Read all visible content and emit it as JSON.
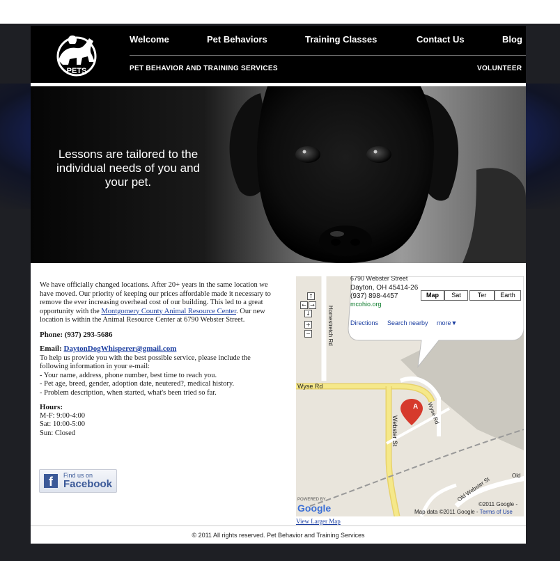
{
  "nav": {
    "items": [
      "Welcome",
      "Pet Behaviors",
      "Training Classes",
      "Contact Us",
      "Blog"
    ],
    "subtitle": "PET BEHAVIOR AND TRAINING SERVICES",
    "volunteer": "VOLUNTEER"
  },
  "logo": {
    "text": "PETS"
  },
  "hero": {
    "tagline": "Lessons are tailored to the individual needs of you and your pet."
  },
  "content": {
    "intro_pre": "We have officially changed locations. After 20+ years in the same location we have moved. Our priority of keeping our prices affordable made it necessary to remove the ever increasing overhead cost of our building. This led to a great opportunity with the ",
    "intro_link": "Montgomery County Animal Resource Center",
    "intro_post": ". Our new location is within the Animal Resource Center at 6790 Webster Street.",
    "phone": "Phone: (937) 293-5686",
    "email_label": "Email: ",
    "email": "DaytonDogWhisperer@gmail.com",
    "email_help": "To help us provide you with the best possible service, please include the following information in your e-mail:",
    "bullets": [
      "- Your name, address, phone number, best time to reach you.",
      "- Pet age, breed, gender, adoption date, neutered?, medical history.",
      "- Problem description, when started, what's been tried so far."
    ],
    "hours_title": "Hours:",
    "hours": [
      "M-F: 9:00-4:00",
      "Sat: 10:00-5:00",
      "Sun: Closed"
    ],
    "facebook_small": "Find us on",
    "facebook_big": "Facebook"
  },
  "map": {
    "street_line": "6790 Webster Street",
    "city_line": "Dayton, OH 45414-26",
    "phone": "(937) 898-4457",
    "site": "mcohio.org",
    "links": [
      "Directions",
      "Search nearby",
      "more▼"
    ],
    "types": [
      "Map",
      "Sat",
      "Ter",
      "Earth"
    ],
    "roads": [
      "Wyse Rd",
      "Webster St",
      "Homestretch Rd",
      "Wyse Rd",
      "Old Webster St",
      "Old"
    ],
    "marker": "A",
    "powered": "POWERED BY",
    "google": "Google",
    "copyright1": "©2011 Google -",
    "copyright2": "Map data ©2011 Google - ",
    "terms": "Terms of Use",
    "larger": "View Larger Map"
  },
  "footer": {
    "copyright": "© 2011 All rights reserved. Pet Behavior and Training Services"
  }
}
